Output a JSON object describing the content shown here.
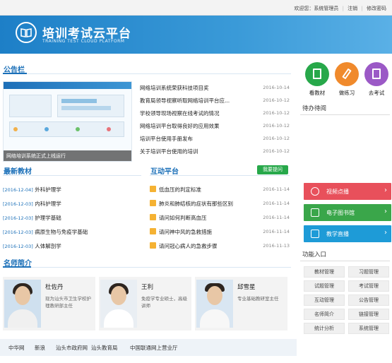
{
  "topbar": {
    "welcome": "欢迎您：系统管理员",
    "logout": "注销",
    "change_password": "修改密码"
  },
  "brand": {
    "title": "培训考试云平台",
    "subtitle": "TRAINING TEST CLOUD PLATFORM"
  },
  "notice": {
    "title": "公告栏",
    "image_caption": "网络培训系统正式上线运行",
    "items": [
      {
        "text": "网络培训系统荣获科技项目奖",
        "date": "2016-10-14"
      },
      {
        "text": "教育局领导视察听取网络培训平台应...",
        "date": "2016-10-12"
      },
      {
        "text": "学校领导现场视察在线考试的情况",
        "date": "2016-10-12"
      },
      {
        "text": "网络培训平台取得良好的应用效果",
        "date": "2016-10-12"
      },
      {
        "text": "培训平台使用手册发布",
        "date": "2016-10-12"
      },
      {
        "text": "关于培训平台使用的培训",
        "date": "2016-10-12"
      }
    ]
  },
  "textbooks": {
    "title": "最新教材",
    "items": [
      {
        "date": "[2016-12-04]",
        "name": "外科护理学"
      },
      {
        "date": "[2016-12-03]",
        "name": "内科护理学"
      },
      {
        "date": "[2016-12-03]",
        "name": "护理学基础"
      },
      {
        "date": "[2016-12-03]",
        "name": "病原生物与免疫学基础"
      },
      {
        "date": "[2016-12-03]",
        "name": "人体解剖学"
      }
    ]
  },
  "interaction": {
    "title": "互动平台",
    "ask_label": "我要提问",
    "items": [
      {
        "text": "低血压的判定标准",
        "date": "2016-11-14"
      },
      {
        "text": "肺炎和肺结核的症状有那些区别",
        "date": "2016-11-14"
      },
      {
        "text": "请问如何判断高血压",
        "date": "2016-11-14"
      },
      {
        "text": "请问神中风的急救措施",
        "date": "2016-11-14"
      },
      {
        "text": "请问冠心病人的急救步骤",
        "date": "2016-11-13"
      }
    ]
  },
  "teachers": {
    "title": "名师简介",
    "items": [
      {
        "name": "杜佐丹",
        "desc": "现为汕头市卫生学校护理教研部主任"
      },
      {
        "name": "王利",
        "desc": "免疫学专业硕士，高级讲师"
      },
      {
        "name": "邱雪星",
        "desc": "专业基础教研室主任"
      }
    ]
  },
  "footer": {
    "links": [
      "中华网",
      "新浪",
      "汕头市政府网",
      "汕头教育局",
      "中国联通网上营业厅"
    ]
  },
  "quick": [
    {
      "label": "看教材",
      "color": "#27a84a"
    },
    {
      "label": "做练习",
      "color": "#f08a2c"
    },
    {
      "label": "去考试",
      "color": "#9b59c6"
    }
  ],
  "todo": {
    "title": "待办待阅"
  },
  "services": [
    {
      "label": "视频点播",
      "color": "#e8505b"
    },
    {
      "label": "电子图书馆",
      "color": "#3aa64a"
    },
    {
      "label": "教学直播",
      "color": "#1e9bd7"
    }
  ],
  "functions": {
    "title": "功能入口",
    "items": [
      "教材管理",
      "习题管理",
      "试题管理",
      "考试管理",
      "互动管理",
      "公告管理",
      "名师简介",
      "链接管理",
      "统计分析",
      "系统管理"
    ]
  }
}
